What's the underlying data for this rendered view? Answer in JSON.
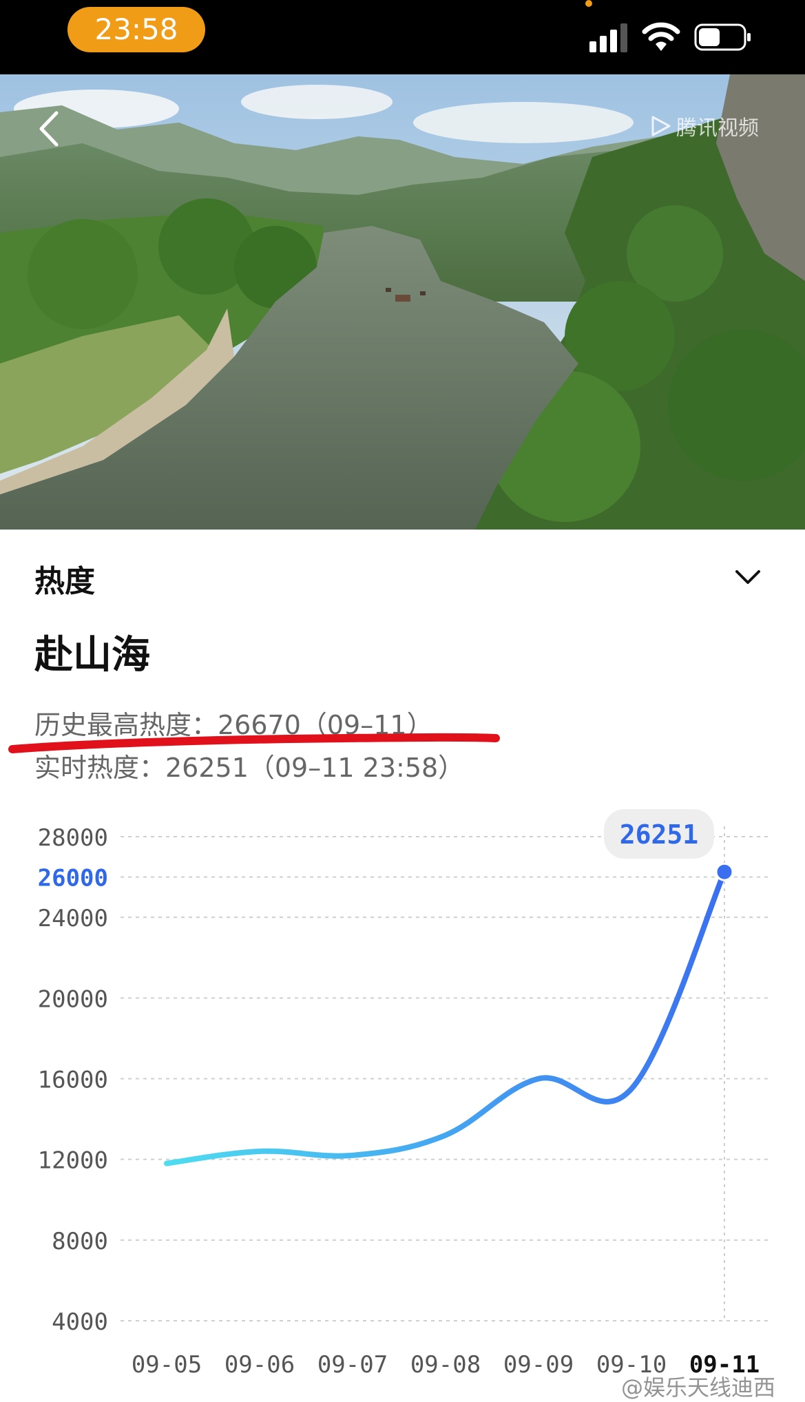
{
  "status_bar": {
    "time": "23:58",
    "time_pill_color": "#f19c16",
    "icons": [
      "cellular-signal-icon",
      "wifi-icon",
      "battery-icon"
    ]
  },
  "video": {
    "watermark": "腾讯视频",
    "back_icon": "chevron-left-icon"
  },
  "heat_panel": {
    "section_title": "热度",
    "collapse_icon": "chevron-down-icon",
    "show_title": "赴山海",
    "history_peak_text": "历史最高热度：26670（09–11）",
    "realtime_text": "实时热度：26251（09–11 23:58）",
    "annotation_color": "#e0111b"
  },
  "chart_data": {
    "type": "line",
    "x": [
      "09-05",
      "09-06",
      "09-07",
      "09-08",
      "09-09",
      "09-10",
      "09-11"
    ],
    "series": [
      {
        "values": [
          11800,
          12400,
          12200,
          13200,
          16000,
          15500,
          26251
        ]
      }
    ],
    "y_ticks": [
      28000,
      26000,
      24000,
      20000,
      16000,
      12000,
      8000,
      4000
    ],
    "highlight_tick": 26000,
    "ylim": [
      4000,
      28000
    ],
    "grid": "dashed-horizontal",
    "callout": "26251",
    "line_color_start": "#4fdcf0",
    "line_color_end": "#3a6ff0",
    "highlight_color": "#2f68e8"
  },
  "footer_watermark": "@娱乐天线迪西"
}
